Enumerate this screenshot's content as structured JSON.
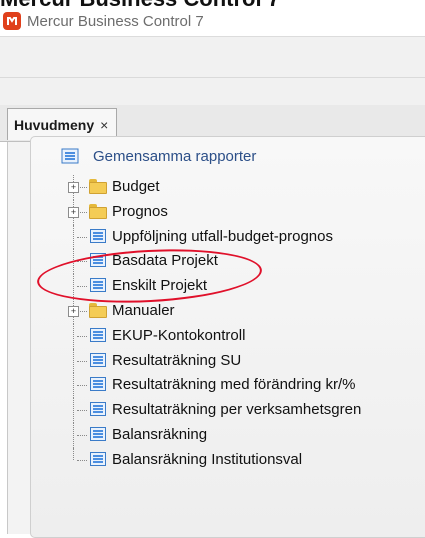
{
  "window": {
    "title": "Mercur Business Control 7"
  },
  "tab": {
    "label": "Huvudmeny",
    "close_glyph": "×"
  },
  "report_group": {
    "label": "Gemensamma rapporter",
    "icon": "report-icon"
  },
  "tree": [
    {
      "label": "Budget",
      "type": "folder",
      "expandable": true
    },
    {
      "label": "Prognos",
      "type": "folder",
      "expandable": true
    },
    {
      "label": "Uppföljning utfall-budget-prognos",
      "type": "report"
    },
    {
      "label": "Basdata Projekt",
      "type": "report",
      "highlighted": true
    },
    {
      "label": "Enskilt Projekt",
      "type": "report"
    },
    {
      "label": "Manualer",
      "type": "folder",
      "expandable": true
    },
    {
      "label": "EKUP-Kontokontroll",
      "type": "report"
    },
    {
      "label": "Resultaträkning SU",
      "type": "report"
    },
    {
      "label": "Resultaträkning med förändring kr/%",
      "type": "report"
    },
    {
      "label": "Resultaträkning per verksamhetsgren",
      "type": "report"
    },
    {
      "label": "Balansräkning",
      "type": "report"
    },
    {
      "label": "Balansräkning Institutionsval",
      "type": "report"
    }
  ],
  "colors": {
    "accent": "#2c4f88",
    "annotation": "#e0102a",
    "logo": "#e0401c"
  }
}
